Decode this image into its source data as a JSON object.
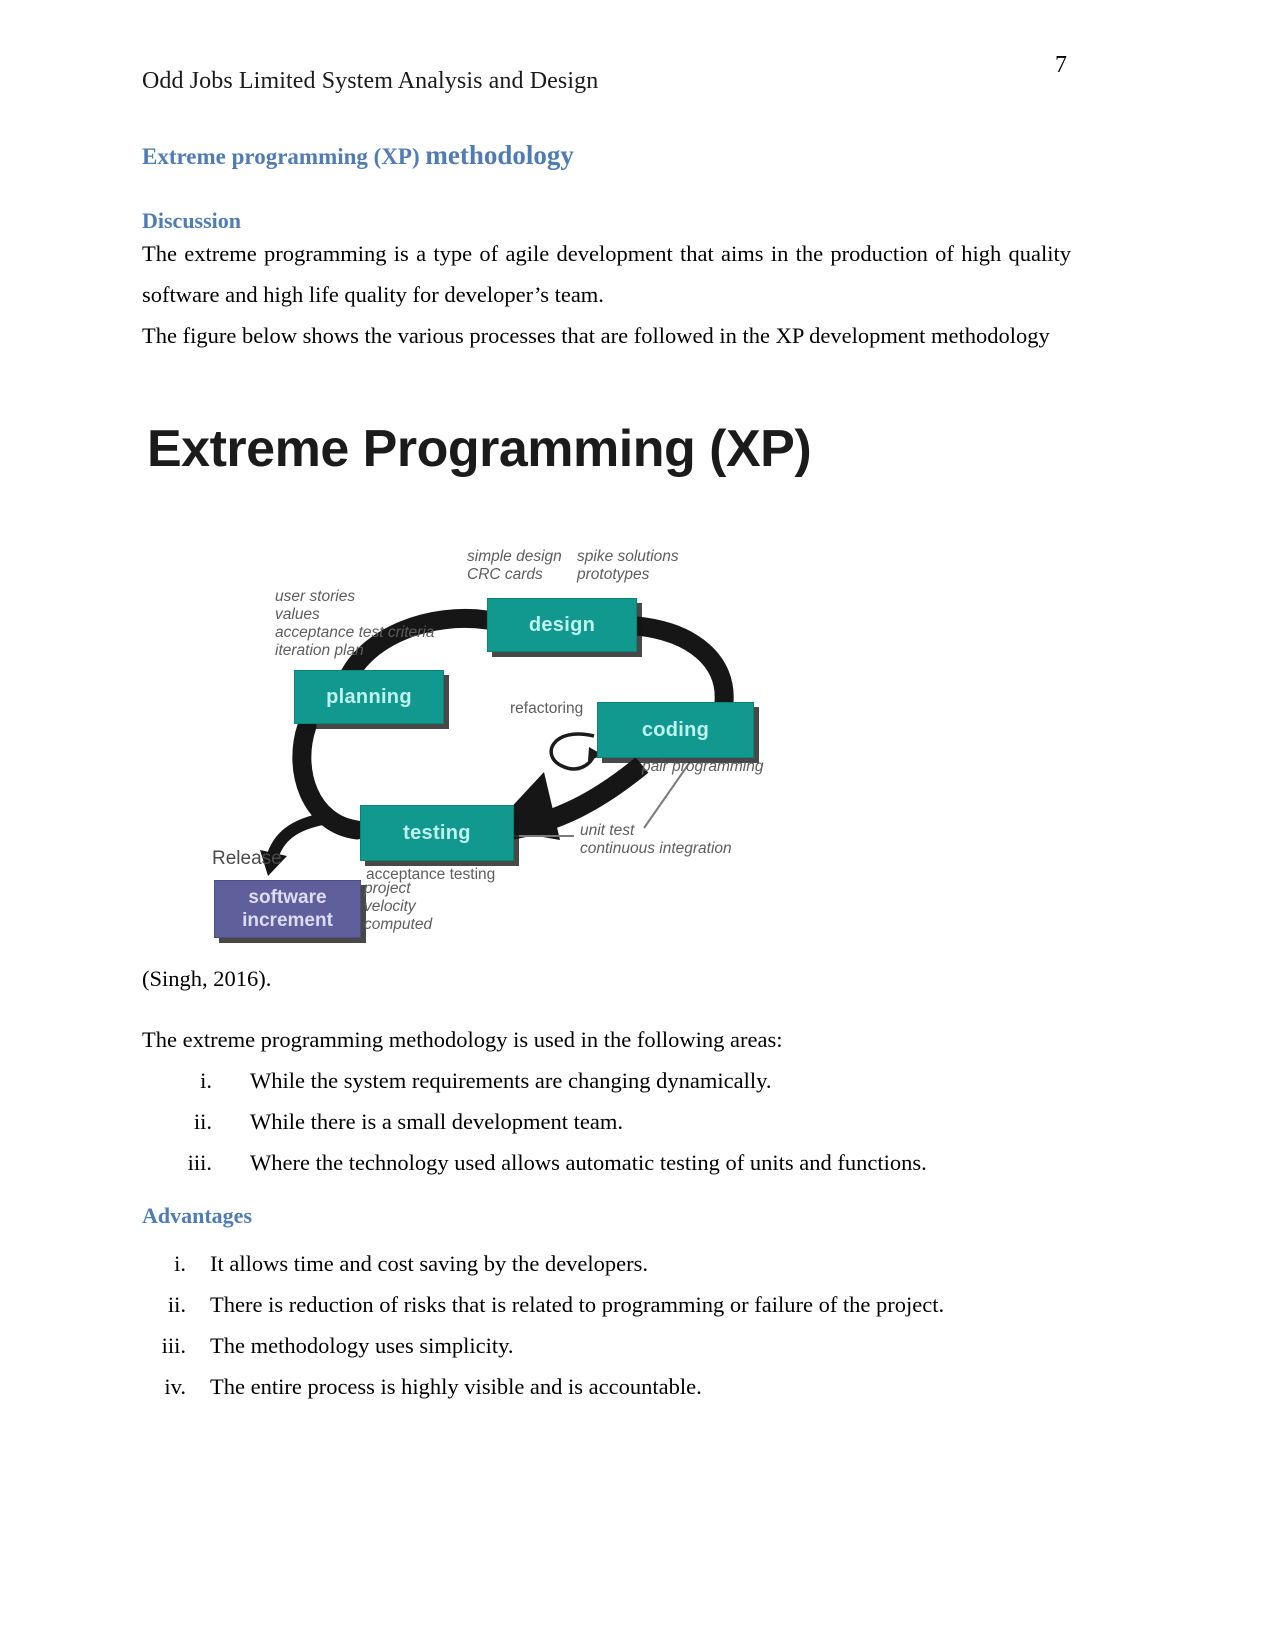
{
  "document": {
    "page_number": "7",
    "running_header": "Odd Jobs Limited System Analysis and Design"
  },
  "headings": {
    "main_part1": "Extreme programming (XP) ",
    "main_part2": "methodology",
    "discussion": "Discussion",
    "advantages": "Advantages"
  },
  "paragraphs": {
    "p1": "The extreme programming is a type of agile development that aims in the production of high quality software and high life quality for developer’s team.",
    "p2": "The figure below shows the various processes that are followed in the XP development methodology",
    "citation": "(Singh, 2016).",
    "p3": "The extreme programming methodology is used in the following areas:"
  },
  "areas_list": [
    {
      "num": "i.",
      "text": "While the system requirements are changing dynamically."
    },
    {
      "num": "ii.",
      "text": "While there is a small development team."
    },
    {
      "num": "iii.",
      "text": "Where the technology used allows automatic testing of units and functions."
    }
  ],
  "advantages_list": [
    {
      "num": "i.",
      "text": "It allows time and cost saving by the developers."
    },
    {
      "num": "ii.",
      "text": "There is reduction of risks that is related to programming or failure of the project."
    },
    {
      "num": "iii.",
      "text": "The methodology uses simplicity."
    },
    {
      "num": "iv.",
      "text": "The entire process is highly visible and is accountable."
    }
  ],
  "figure": {
    "title": "Extreme Programming (XP)",
    "boxes": {
      "design": "design",
      "planning": "planning",
      "coding": "coding",
      "testing": "testing",
      "software_increment_line1": "software",
      "software_increment_line2": "increment"
    },
    "labels": {
      "simple_design_line1": "simple design",
      "simple_design_line2": "CRC cards",
      "spike_line1": "spike solutions",
      "spike_line2": "prototypes",
      "inputs_line1": "user stories",
      "inputs_line2": "values",
      "inputs_line3": "acceptance test criteria",
      "inputs_line4": "iteration plan",
      "refactoring": "refactoring",
      "pair_programming": "pair programming",
      "unit_test_line1": "unit test",
      "unit_test_line2": "continuous integration",
      "acceptance_testing": "acceptance testing",
      "release": "Release",
      "project_velocity_line1": "project",
      "project_velocity_line2": "velocity",
      "project_velocity_line3": "computed"
    },
    "colors": {
      "process_box": "#12998f",
      "increment_box": "#5f5f9c",
      "heading_blue": "#4f7cb5"
    }
  }
}
